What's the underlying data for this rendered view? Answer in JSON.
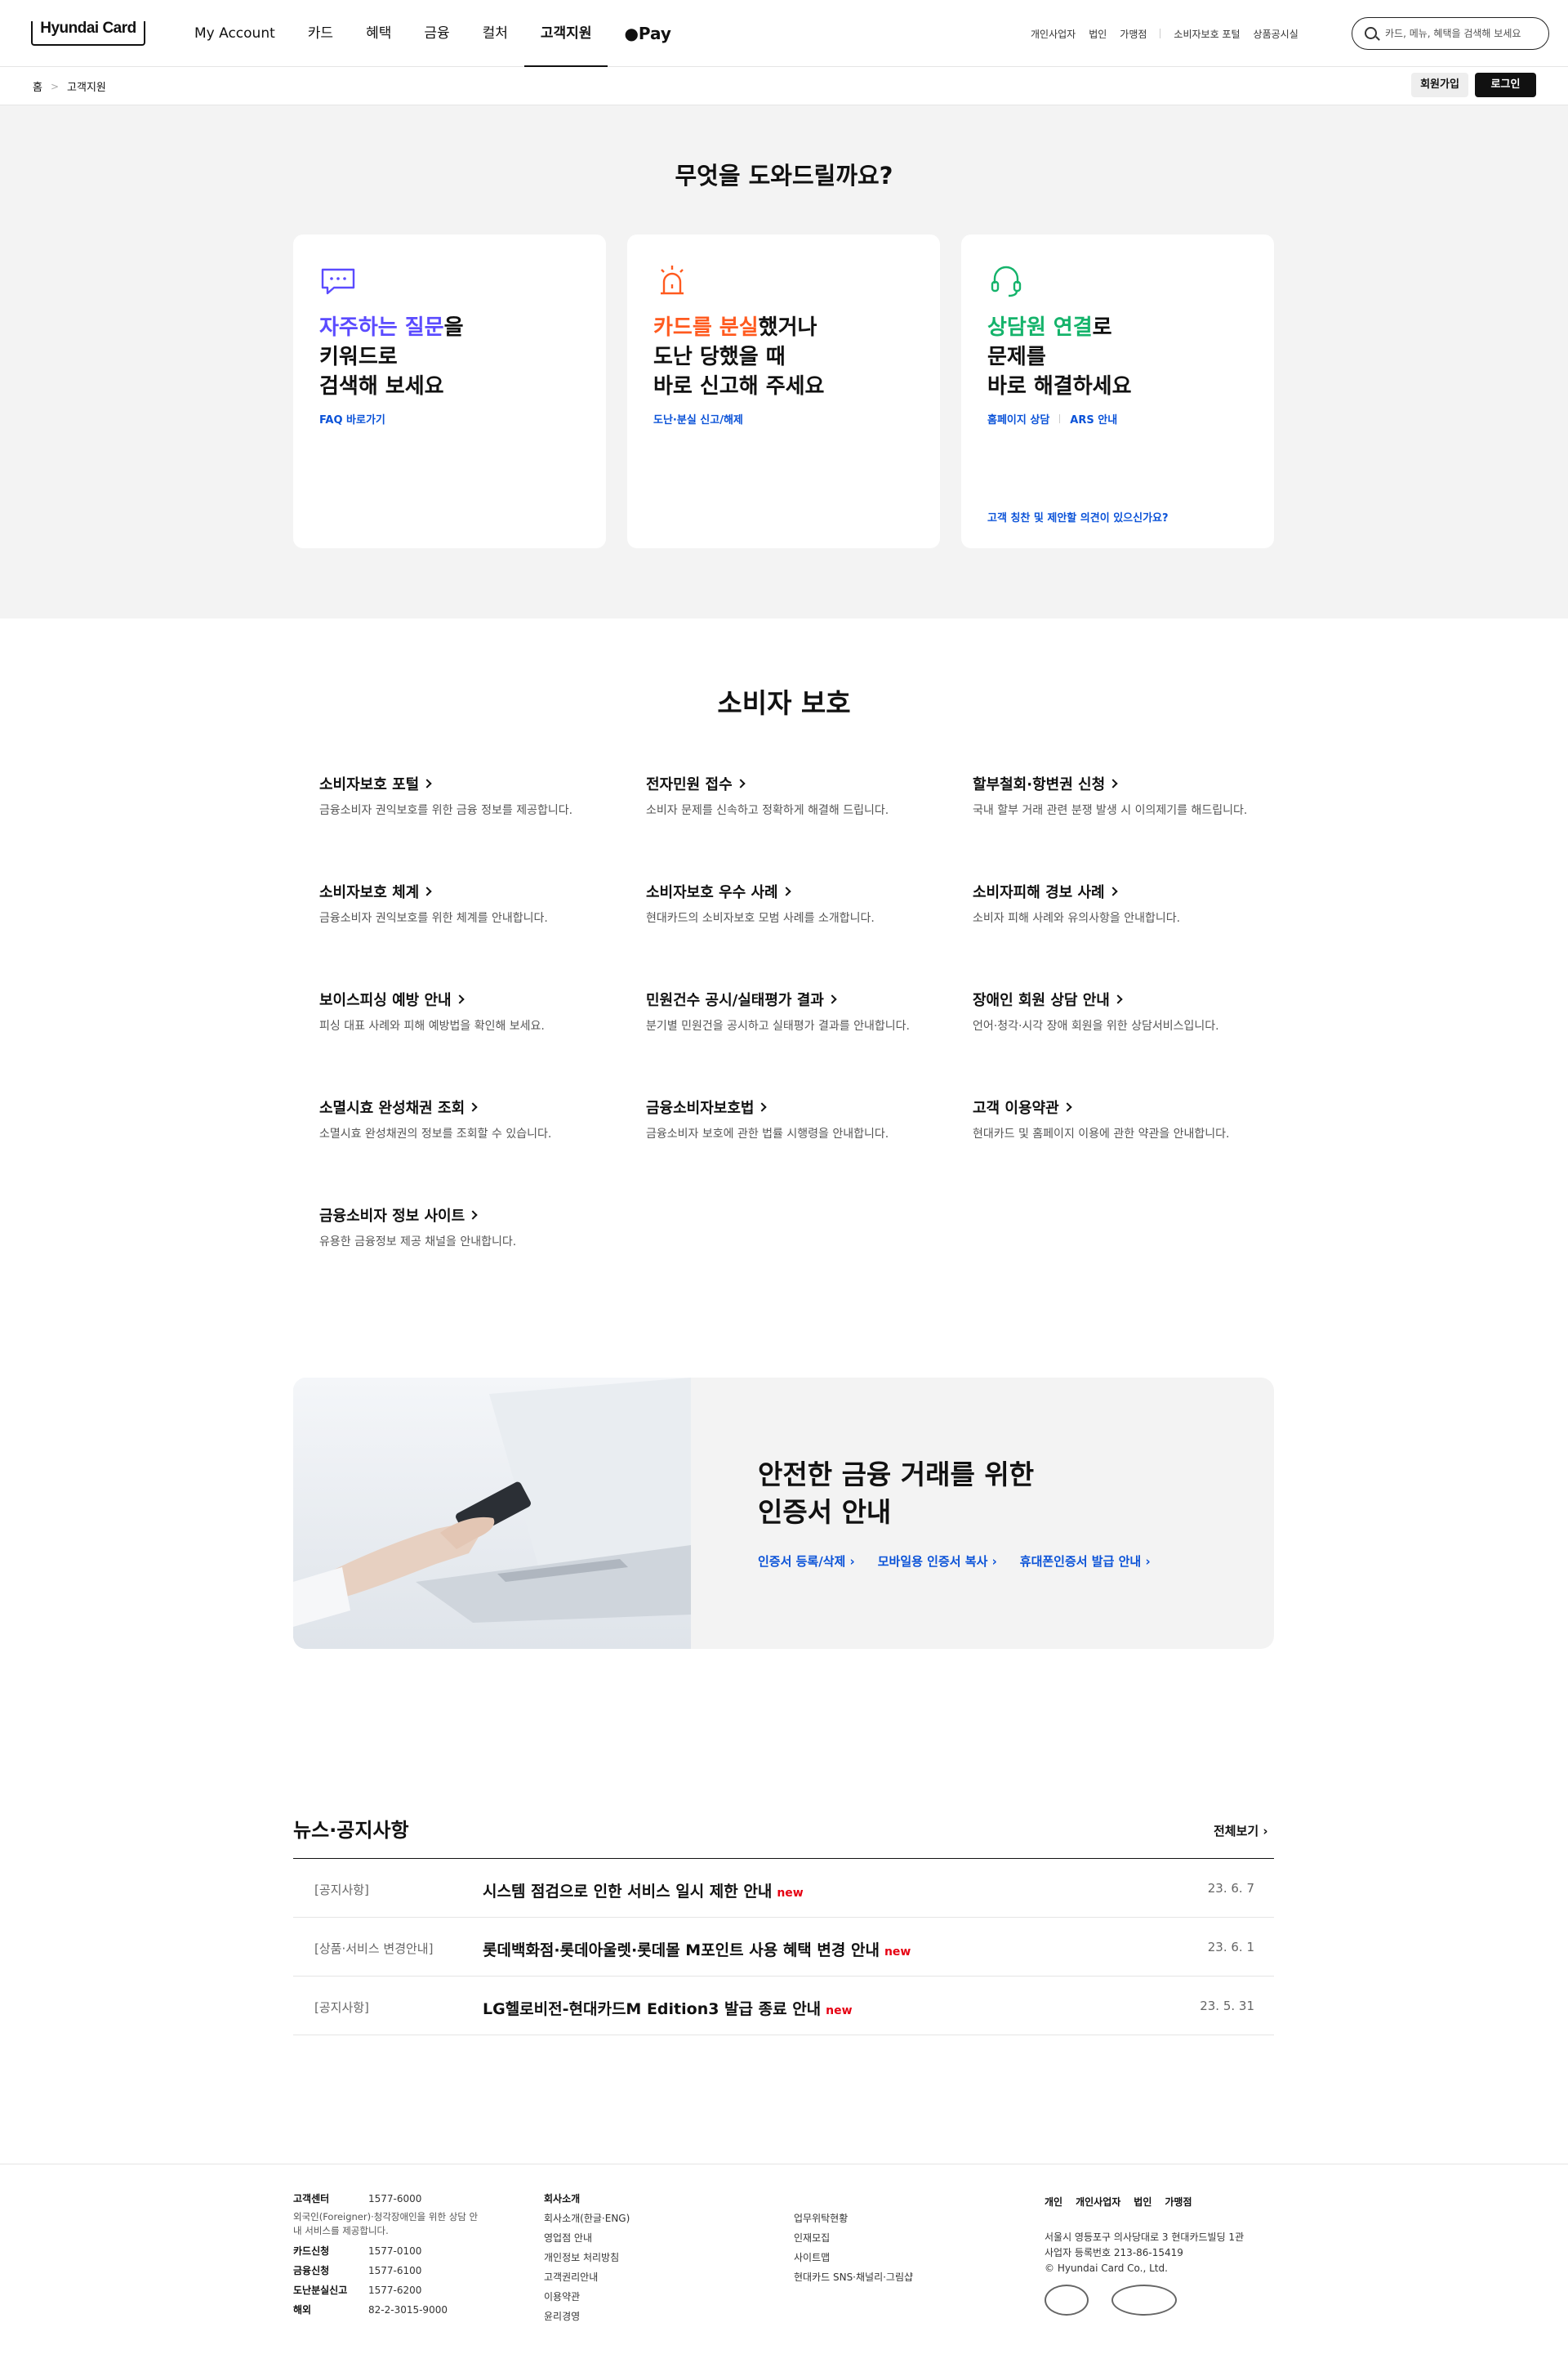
{
  "header": {
    "logo_text": "Hyundai Card",
    "menu": [
      "My Account",
      "카드",
      "혜택",
      "금융",
      "컬처",
      "고객지원"
    ],
    "active_menu": "고객지원",
    "pay_label": "Pay",
    "util_group1": [
      "개인사업자",
      "법인",
      "가맹점"
    ],
    "util_group2": [
      "소비자보호 포털",
      "상품공시실"
    ],
    "search_placeholder": "카드, 메뉴, 혜택을 검색해 보세요"
  },
  "breadcrumb": {
    "home": "홈",
    "current": "고객지원"
  },
  "auth": {
    "join": "회원가입",
    "login": "로그인"
  },
  "help": {
    "title": "무엇을 도와드릴까요?",
    "cards": [
      {
        "hl": "자주하는 질문",
        "hl_color": "#5b4bff",
        "rest": "을",
        "line2": "키워드로",
        "line3": "검색해 보세요",
        "links": [
          "FAQ 바로가기"
        ],
        "icon": "chat-bubble-icon"
      },
      {
        "hl": "카드를 분실",
        "hl_color": "#ff5a1f",
        "rest": "했거나",
        "line2": "도난 당했을 때",
        "line3": "바로 신고해 주세요",
        "links": [
          "도난·분실 신고/해제"
        ],
        "icon": "siren-icon"
      },
      {
        "hl": "상담원 연결",
        "hl_color": "#15b36b",
        "rest": "로",
        "line2": "문제를",
        "line3": "바로 해결하세요",
        "links": [
          "홈페이지 상담",
          "ARS 안내"
        ],
        "bottom": "고객 칭찬 및 제안할 의견이 있으신가요?",
        "icon": "headset-icon"
      }
    ]
  },
  "consumer": {
    "title": "소비자 보호",
    "items": [
      {
        "t": "소비자보호 포털",
        "d": "금융소비자 권익보호를 위한 금융 정보를 제공합니다."
      },
      {
        "t": "전자민원 접수",
        "d": "소비자 문제를 신속하고 정확하게 해결해 드립니다."
      },
      {
        "t": "할부철회·항변권 신청",
        "d": "국내 할부 거래 관련 분쟁 발생 시 이의제기를 해드립니다."
      },
      {
        "t": "소비자보호 체계",
        "d": "금융소비자 권익보호를 위한 체계를 안내합니다."
      },
      {
        "t": "소비자보호 우수 사례",
        "d": "현대카드의 소비자보호 모범 사례를 소개합니다."
      },
      {
        "t": "소비자피해 경보 사례",
        "d": "소비자 피해 사례와 유의사항을 안내합니다."
      },
      {
        "t": "보이스피싱 예방 안내",
        "d": "피싱 대표 사례와 피해 예방법을 확인해 보세요."
      },
      {
        "t": "민원건수 공시/실태평가 결과",
        "d": "분기별 민원건을 공시하고 실태평가 결과를 안내합니다."
      },
      {
        "t": "장애인 회원 상담 안내",
        "d": "언어·청각·시각 장애 회원을 위한 상담서비스입니다."
      },
      {
        "t": "소멸시효 완성채권 조회",
        "d": "소멸시효 완성채권의 정보를 조회할 수 있습니다."
      },
      {
        "t": "금융소비자보호법",
        "d": "금융소비자 보호에 관한 법률 시행령을 안내합니다."
      },
      {
        "t": "고객 이용약관",
        "d": "현대카드 및 홈페이지 이용에 관한 약관을 안내합니다."
      },
      {
        "t": "금융소비자 정보 사이트",
        "d": "유용한 금융정보 제공 채널을 안내합니다."
      }
    ]
  },
  "cert": {
    "line1": "안전한 금융 거래를 위한",
    "line2": "인증서 안내",
    "links": [
      "인증서 등록/삭제 ›",
      "모바일용 인증서 복사 ›",
      "휴대폰인증서 발급 안내 ›"
    ]
  },
  "news": {
    "title": "뉴스·공지사항",
    "view_all": "전체보기 ›",
    "rows": [
      {
        "cat": "[공지사항]",
        "title": "시스템 점검으로 인한 서비스 일시 제한 안내",
        "badge": "new",
        "date": "23. 6. 7"
      },
      {
        "cat": "[상품·서비스 변경안내]",
        "title": "롯데백화점·롯데아울렛·롯데몰 M포인트 사용 혜택 변경 안내",
        "badge": "new",
        "date": "23. 6. 1"
      },
      {
        "cat": "[공지사항]",
        "title": "LG헬로비전-현대카드M Edition3 발급 종료 안내",
        "badge": "new",
        "date": "23. 5. 31"
      }
    ]
  },
  "footer": {
    "center_label": "고객센터",
    "center_tel": "1577-6000",
    "foreigner_note": "외국인(Foreigner)·청각장애인을 위한 상담 안내 서비스를 제공합니다.",
    "contacts": [
      [
        "카드신청",
        "1577-0100"
      ],
      [
        "금융신청",
        "1577-6100"
      ],
      [
        "도난분실신고",
        "1577-6200"
      ],
      [
        "해외",
        "82-2-3015-9000"
      ]
    ],
    "company_title": "회사소개",
    "company_links": [
      "회사소개(한글·ENG)",
      "영업점 안내",
      "개인정보 처리방침",
      "고객권리안내",
      "이용약관",
      "윤리경영"
    ],
    "other_links": [
      "업무위탁현황",
      "인재모집",
      "사이트맵",
      "현대카드 SNS·채널리·그림샵"
    ],
    "site_links": [
      "개인",
      "개인사업자",
      "법인",
      "가맹점"
    ],
    "address": "서울시 영등포구 의사당대로 3 현대카드빌딩 1관",
    "biz_no": "사업자 등록번호 213-86-15419",
    "copyright": "© Hyundai Card Co., Ltd."
  }
}
